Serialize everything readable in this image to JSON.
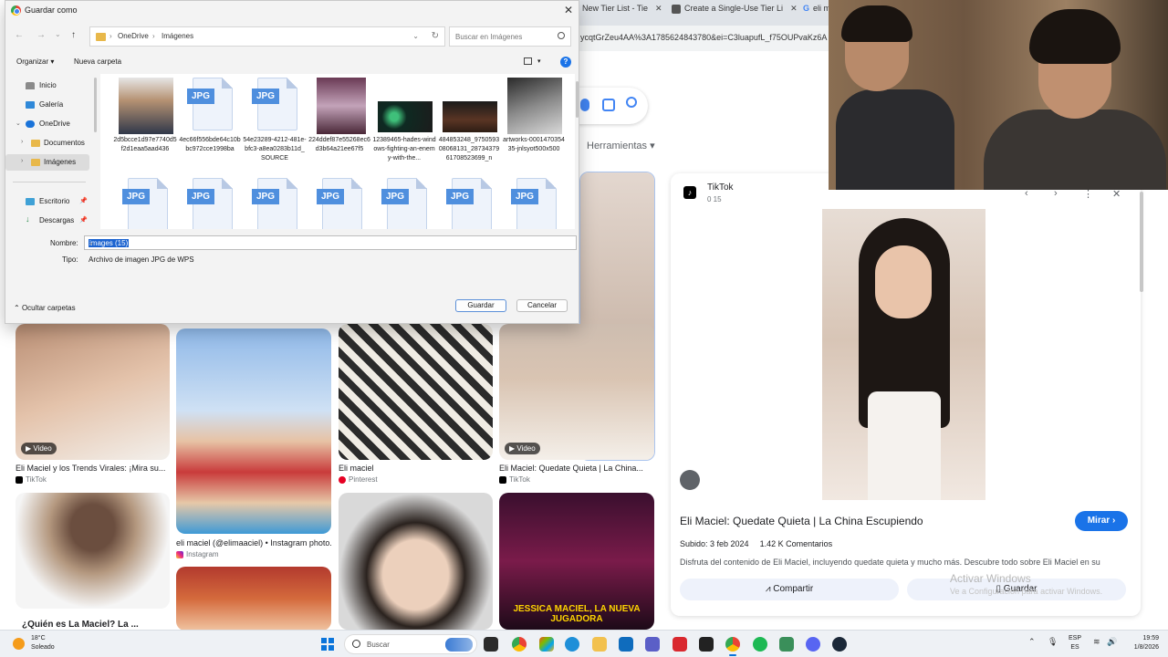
{
  "browser": {
    "tabs": [
      {
        "label": "New Tier List - Tie"
      },
      {
        "label": "Create a Single-Use Tier Li"
      },
      {
        "label": "eli m"
      }
    ],
    "url": "ycqtGrZeu4AA%3A1785624843780&ei=C3luapufL_f75OUPvaKz6A"
  },
  "google": {
    "tools_label": "Herramientas"
  },
  "grid": {
    "video_badge": "▶ Video",
    "items": [
      {
        "caption": "Eli Maciel y los Trends Virales: ¡Mira su...",
        "source": "TikTok"
      },
      {
        "caption": "eli maciel (@elimaaciel) • Instagram photo...",
        "source": "Instagram"
      },
      {
        "caption": "Eli maciel",
        "source": "Pinterest"
      },
      {
        "caption": "Eli Maciel: Quedate Quieta | La China...",
        "source": "TikTok"
      },
      {
        "caption": "¿Quién es La Maciel? La ...",
        "source": ""
      }
    ],
    "crown_text": "JESSICA MACIEL, LA NUEVA JUGADORA"
  },
  "panel": {
    "source_name": "TikTok",
    "source_count": "0 15",
    "title": "Eli Maciel: Quedate Quieta | La China Escupiendo",
    "mirar": "Mirar",
    "subido": "Subido: 3 feb 2024",
    "comentarios": "1.42 K Comentarios",
    "description": "Disfruta del contenido de Eli Maciel, incluyendo quedate quieta y mucho más. Descubre todo sobre Eli Maciel en su",
    "share": "Compartir",
    "save": "Guardar"
  },
  "watermark": {
    "line1": "Activar Windows",
    "line2": "Ve a Configuración para activar Windows."
  },
  "dialog": {
    "title": "Guardar como",
    "breadcrumb": [
      "OneDrive",
      "Imágenes"
    ],
    "search_placeholder": "Buscar en Imágenes",
    "organize": "Organizar",
    "new_folder": "Nueva carpeta",
    "nav": [
      {
        "label": "Inicio"
      },
      {
        "label": "Galería"
      },
      {
        "label": "OneDrive"
      },
      {
        "label": "Documentos"
      },
      {
        "label": "Imágenes"
      },
      {
        "label": "Escritorio"
      },
      {
        "label": "Descargas"
      }
    ],
    "files": [
      {
        "name": "2d5bcce1d97e7740d5f2d1eaa5aad436"
      },
      {
        "name": "4ec66f556bde64c10bbc972cce1998ba"
      },
      {
        "name": "54e23289-4212-481e-bfc3-a8ea0283b11d_SOURCE"
      },
      {
        "name": "224ddef87e55268ec6d3b64a21ee67f5"
      },
      {
        "name": "12389465-hades-windows-fighting-an-enemy-with-the..."
      },
      {
        "name": "484853248_975059308068131_2873437961708523699_n"
      },
      {
        "name": "artworks-000147035435-jnlsyot500x500"
      },
      {
        "name": ""
      },
      {
        "name": ""
      },
      {
        "name": ""
      },
      {
        "name": ""
      },
      {
        "name": ""
      },
      {
        "name": ""
      },
      {
        "name": ""
      }
    ],
    "jpg_badge": "JPG",
    "filename_label": "Nombre:",
    "filename_value": "images (15)",
    "type_label": "Tipo:",
    "type_value": "Archivo de imagen JPG de WPS",
    "hide_folders": "Ocultar carpetas",
    "save": "Guardar",
    "cancel": "Cancelar"
  },
  "taskbar": {
    "temp": "18°C",
    "condition": "Soleado",
    "search": "Buscar",
    "lang1": "ESP",
    "lang2": "ES",
    "time": "19:59",
    "date": "1/8/2026"
  }
}
